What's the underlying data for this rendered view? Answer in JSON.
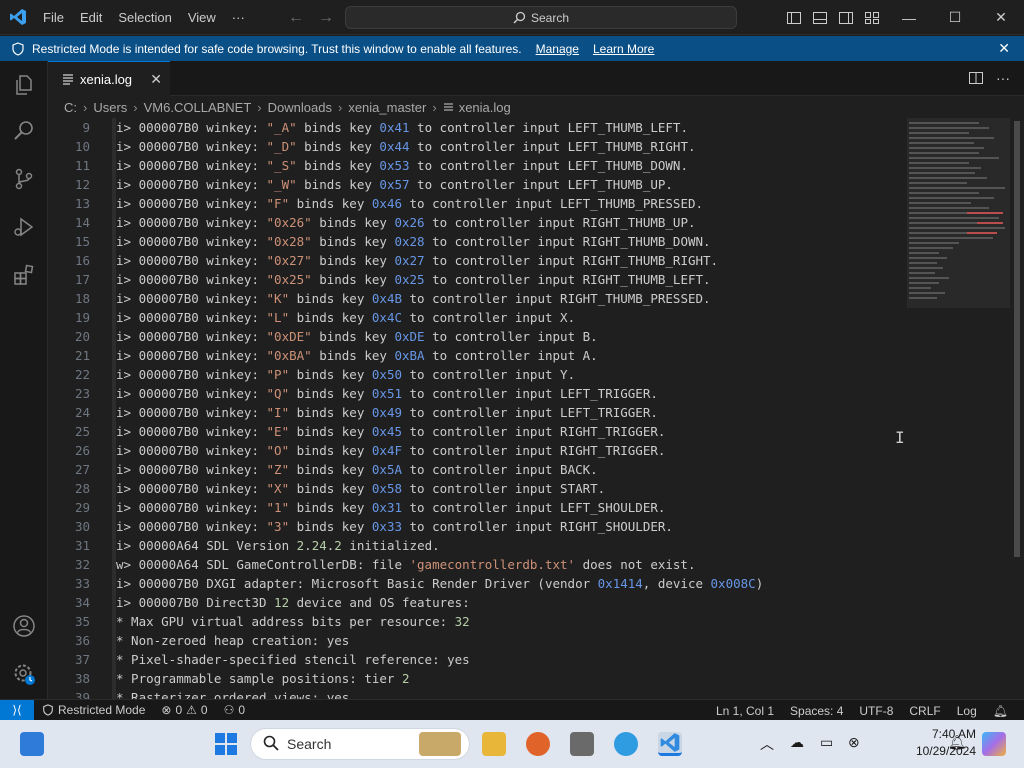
{
  "titlebar": {
    "menu": [
      "File",
      "Edit",
      "Selection",
      "View",
      "···"
    ],
    "search_label": "Search"
  },
  "banner": {
    "message": "Restricted Mode is intended for safe code browsing. Trust this window to enable all features.",
    "manage": "Manage",
    "learn_more": "Learn More"
  },
  "tab": {
    "label": "xenia.log"
  },
  "breadcrumb": [
    "C:",
    "Users",
    "VM6.COLLABNET",
    "Downloads",
    "xenia_master",
    "xenia.log"
  ],
  "code_lines": [
    {
      "n": "9",
      "parts": [
        [
          "t",
          "i> 000007B0 winkey: "
        ],
        [
          "s",
          "\"_A\""
        ],
        [
          "t",
          " binds key "
        ],
        [
          "h",
          "0x41"
        ],
        [
          "t",
          " to controller input LEFT_THUMB_LEFT."
        ]
      ]
    },
    {
      "n": "10",
      "parts": [
        [
          "t",
          "i> 000007B0 winkey: "
        ],
        [
          "s",
          "\"_D\""
        ],
        [
          "t",
          " binds key "
        ],
        [
          "h",
          "0x44"
        ],
        [
          "t",
          " to controller input LEFT_THUMB_RIGHT."
        ]
      ]
    },
    {
      "n": "11",
      "parts": [
        [
          "t",
          "i> 000007B0 winkey: "
        ],
        [
          "s",
          "\"_S\""
        ],
        [
          "t",
          " binds key "
        ],
        [
          "h",
          "0x53"
        ],
        [
          "t",
          " to controller input LEFT_THUMB_DOWN."
        ]
      ]
    },
    {
      "n": "12",
      "parts": [
        [
          "t",
          "i> 000007B0 winkey: "
        ],
        [
          "s",
          "\"_W\""
        ],
        [
          "t",
          " binds key "
        ],
        [
          "h",
          "0x57"
        ],
        [
          "t",
          " to controller input LEFT_THUMB_UP."
        ]
      ]
    },
    {
      "n": "13",
      "parts": [
        [
          "t",
          "i> 000007B0 winkey: "
        ],
        [
          "s",
          "\"F\""
        ],
        [
          "t",
          " binds key "
        ],
        [
          "h",
          "0x46"
        ],
        [
          "t",
          " to controller input LEFT_THUMB_PRESSED."
        ]
      ]
    },
    {
      "n": "14",
      "parts": [
        [
          "t",
          "i> 000007B0 winkey: "
        ],
        [
          "s",
          "\"0x26\""
        ],
        [
          "t",
          " binds key "
        ],
        [
          "h",
          "0x26"
        ],
        [
          "t",
          " to controller input RIGHT_THUMB_UP."
        ]
      ]
    },
    {
      "n": "15",
      "parts": [
        [
          "t",
          "i> 000007B0 winkey: "
        ],
        [
          "s",
          "\"0x28\""
        ],
        [
          "t",
          " binds key "
        ],
        [
          "h",
          "0x28"
        ],
        [
          "t",
          " to controller input RIGHT_THUMB_DOWN."
        ]
      ]
    },
    {
      "n": "16",
      "parts": [
        [
          "t",
          "i> 000007B0 winkey: "
        ],
        [
          "s",
          "\"0x27\""
        ],
        [
          "t",
          " binds key "
        ],
        [
          "h",
          "0x27"
        ],
        [
          "t",
          " to controller input RIGHT_THUMB_RIGHT."
        ]
      ]
    },
    {
      "n": "17",
      "parts": [
        [
          "t",
          "i> 000007B0 winkey: "
        ],
        [
          "s",
          "\"0x25\""
        ],
        [
          "t",
          " binds key "
        ],
        [
          "h",
          "0x25"
        ],
        [
          "t",
          " to controller input RIGHT_THUMB_LEFT."
        ]
      ]
    },
    {
      "n": "18",
      "parts": [
        [
          "t",
          "i> 000007B0 winkey: "
        ],
        [
          "s",
          "\"K\""
        ],
        [
          "t",
          " binds key "
        ],
        [
          "h",
          "0x4B"
        ],
        [
          "t",
          " to controller input RIGHT_THUMB_PRESSED."
        ]
      ]
    },
    {
      "n": "19",
      "parts": [
        [
          "t",
          "i> 000007B0 winkey: "
        ],
        [
          "s",
          "\"L\""
        ],
        [
          "t",
          " binds key "
        ],
        [
          "h",
          "0x4C"
        ],
        [
          "t",
          " to controller input X."
        ]
      ]
    },
    {
      "n": "20",
      "parts": [
        [
          "t",
          "i> 000007B0 winkey: "
        ],
        [
          "s",
          "\"0xDE\""
        ],
        [
          "t",
          " binds key "
        ],
        [
          "h",
          "0xDE"
        ],
        [
          "t",
          " to controller input B."
        ]
      ]
    },
    {
      "n": "21",
      "parts": [
        [
          "t",
          "i> 000007B0 winkey: "
        ],
        [
          "s",
          "\"0xBA\""
        ],
        [
          "t",
          " binds key "
        ],
        [
          "h",
          "0xBA"
        ],
        [
          "t",
          " to controller input A."
        ]
      ]
    },
    {
      "n": "22",
      "parts": [
        [
          "t",
          "i> 000007B0 winkey: "
        ],
        [
          "s",
          "\"P\""
        ],
        [
          "t",
          " binds key "
        ],
        [
          "h",
          "0x50"
        ],
        [
          "t",
          " to controller input Y."
        ]
      ]
    },
    {
      "n": "23",
      "parts": [
        [
          "t",
          "i> 000007B0 winkey: "
        ],
        [
          "s",
          "\"Q\""
        ],
        [
          "t",
          " binds key "
        ],
        [
          "h",
          "0x51"
        ],
        [
          "t",
          " to controller input LEFT_TRIGGER."
        ]
      ]
    },
    {
      "n": "24",
      "parts": [
        [
          "t",
          "i> 000007B0 winkey: "
        ],
        [
          "s",
          "\"I\""
        ],
        [
          "t",
          " binds key "
        ],
        [
          "h",
          "0x49"
        ],
        [
          "t",
          " to controller input LEFT_TRIGGER."
        ]
      ]
    },
    {
      "n": "25",
      "parts": [
        [
          "t",
          "i> 000007B0 winkey: "
        ],
        [
          "s",
          "\"E\""
        ],
        [
          "t",
          " binds key "
        ],
        [
          "h",
          "0x45"
        ],
        [
          "t",
          " to controller input RIGHT_TRIGGER."
        ]
      ]
    },
    {
      "n": "26",
      "parts": [
        [
          "t",
          "i> 000007B0 winkey: "
        ],
        [
          "s",
          "\"O\""
        ],
        [
          "t",
          " binds key "
        ],
        [
          "h",
          "0x4F"
        ],
        [
          "t",
          " to controller input RIGHT_TRIGGER."
        ]
      ]
    },
    {
      "n": "27",
      "parts": [
        [
          "t",
          "i> 000007B0 winkey: "
        ],
        [
          "s",
          "\"Z\""
        ],
        [
          "t",
          " binds key "
        ],
        [
          "h",
          "0x5A"
        ],
        [
          "t",
          " to controller input BACK."
        ]
      ]
    },
    {
      "n": "28",
      "parts": [
        [
          "t",
          "i> 000007B0 winkey: "
        ],
        [
          "s",
          "\"X\""
        ],
        [
          "t",
          " binds key "
        ],
        [
          "h",
          "0x58"
        ],
        [
          "t",
          " to controller input START."
        ]
      ]
    },
    {
      "n": "29",
      "parts": [
        [
          "t",
          "i> 000007B0 winkey: "
        ],
        [
          "s",
          "\"1\""
        ],
        [
          "t",
          " binds key "
        ],
        [
          "h",
          "0x31"
        ],
        [
          "t",
          " to controller input LEFT_SHOULDER."
        ]
      ]
    },
    {
      "n": "30",
      "parts": [
        [
          "t",
          "i> 000007B0 winkey: "
        ],
        [
          "s",
          "\"3\""
        ],
        [
          "t",
          " binds key "
        ],
        [
          "h",
          "0x33"
        ],
        [
          "t",
          " to controller input RIGHT_SHOULDER."
        ]
      ]
    },
    {
      "n": "31",
      "parts": [
        [
          "t",
          "i> 00000A64 SDL Version "
        ],
        [
          "n",
          "2"
        ],
        [
          "t",
          "."
        ],
        [
          "n",
          "24"
        ],
        [
          "t",
          "."
        ],
        [
          "n",
          "2"
        ],
        [
          "t",
          " initialized."
        ]
      ]
    },
    {
      "n": "32",
      "parts": [
        [
          "t",
          "w> 00000A64 SDL GameControllerDB: file "
        ],
        [
          "s",
          "'gamecontrollerdb.txt'"
        ],
        [
          "t",
          " does not exist."
        ]
      ]
    },
    {
      "n": "33",
      "parts": [
        [
          "t",
          "i> 000007B0 DXGI adapter: Microsoft Basic Render Driver (vendor "
        ],
        [
          "h",
          "0x1414"
        ],
        [
          "t",
          ", device "
        ],
        [
          "h",
          "0x008C"
        ],
        [
          "t",
          ")"
        ]
      ]
    },
    {
      "n": "34",
      "parts": [
        [
          "t",
          "i> 000007B0 Direct3D "
        ],
        [
          "n",
          "12"
        ],
        [
          "t",
          " device and OS features:"
        ]
      ]
    },
    {
      "n": "35",
      "parts": [
        [
          "t",
          "* Max GPU virtual address bits per resource: "
        ],
        [
          "n",
          "32"
        ]
      ]
    },
    {
      "n": "36",
      "parts": [
        [
          "t",
          "* Non-zeroed heap creation: yes"
        ]
      ]
    },
    {
      "n": "37",
      "parts": [
        [
          "t",
          "* Pixel-shader-specified stencil reference: yes"
        ]
      ]
    },
    {
      "n": "38",
      "parts": [
        [
          "t",
          "* Programmable sample positions: tier "
        ],
        [
          "n",
          "2"
        ]
      ]
    },
    {
      "n": "39",
      "parts": [
        [
          "t",
          "* Rasterizer ordered views: yes"
        ]
      ]
    }
  ],
  "statusbar": {
    "restricted": "Restricted Mode",
    "errors": "0",
    "warnings": "0",
    "ports": "0",
    "position": "Ln 1, Col 1",
    "spaces": "Spaces: 4",
    "encoding": "UTF-8",
    "eol": "CRLF",
    "language": "Log"
  },
  "taskbar": {
    "search_label": "Search",
    "time": "7:40 AM",
    "date": "10/29/2024"
  },
  "colors": {
    "accent": "#0078d4",
    "banner": "#0a4f86",
    "string": "#ce9178",
    "hex": "#6796e6",
    "number": "#b5cea8"
  }
}
